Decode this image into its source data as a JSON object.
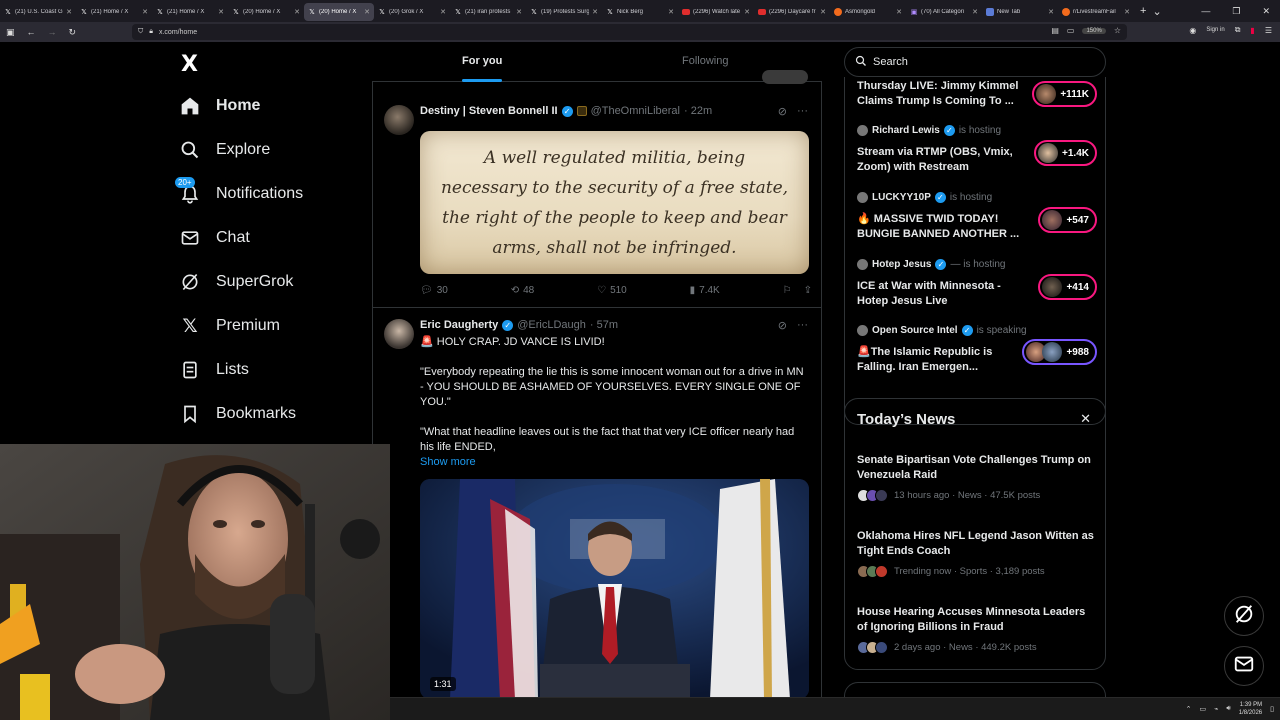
{
  "browser": {
    "tabs": [
      {
        "label": "(21) U.S. Coast G",
        "favicon": "x-icon",
        "active": false
      },
      {
        "label": "(21) Home / X",
        "favicon": "x-icon",
        "active": false
      },
      {
        "label": "(21) Home / X",
        "favicon": "x-icon",
        "active": false
      },
      {
        "label": "(20) Home / X",
        "favicon": "x-icon",
        "active": false
      },
      {
        "label": "(20) Home / X",
        "favicon": "x-icon",
        "active": true
      },
      {
        "label": "(20) Grok / X",
        "favicon": "x-icon",
        "active": false
      },
      {
        "label": "(21) iran protests",
        "favicon": "x-icon",
        "active": false
      },
      {
        "label": "(19) Protests Surg",
        "favicon": "x-icon",
        "active": false
      },
      {
        "label": "Nick Berg",
        "favicon": "x-icon",
        "active": false
      },
      {
        "label": "(2296) Watch late",
        "favicon": "youtube-icon",
        "active": false
      },
      {
        "label": "(2296) Daycare fr",
        "favicon": "youtube-icon",
        "active": false
      },
      {
        "label": "Asmongold",
        "favicon": "reddit-icon",
        "active": false
      },
      {
        "label": "(70) All Categori",
        "favicon": "twitch-icon",
        "active": false
      },
      {
        "label": "New Tab",
        "favicon": "firefox-icon",
        "active": false
      },
      {
        "label": "r/LivestreamFail",
        "favicon": "reddit-icon",
        "active": false
      }
    ],
    "url": "x.com/home",
    "zoom": "150%",
    "signin_label": "Sign in"
  },
  "nav": {
    "logo": "X",
    "items": [
      {
        "label": "Home",
        "icon": "home-icon"
      },
      {
        "label": "Explore",
        "icon": "search-icon"
      },
      {
        "label": "Notifications",
        "icon": "bell-icon",
        "badge": "20+"
      },
      {
        "label": "Chat",
        "icon": "mail-icon"
      },
      {
        "label": "SuperGrok",
        "icon": "grok-icon"
      },
      {
        "label": "Premium",
        "icon": "x-icon"
      },
      {
        "label": "Lists",
        "icon": "list-icon"
      },
      {
        "label": "Bookmarks",
        "icon": "bookmark-icon"
      }
    ]
  },
  "feed": {
    "tabs": [
      {
        "label": "For you"
      },
      {
        "label": "Following"
      }
    ],
    "tweets": [
      {
        "name": "Destiny | Steven Bonnell II",
        "handle": "@TheOmniLiberal",
        "time": "· 22m",
        "image_text": "A well regulated militia, being necessary to the security of a free state, the right of the people to keep and bear arms, shall not be infringed.",
        "replies": "30",
        "reposts": "48",
        "likes": "510",
        "views": "7.4K"
      },
      {
        "name": "Eric Daugherty",
        "handle": "@EricLDaugh",
        "time": "· 57m",
        "line1": "🚨 HOLY CRAP. JD VANCE IS LIVID!",
        "para1": "\"Everybody repeating the lie this is some innocent woman out for a drive in MN - YOU SHOULD BE ASHAMED OF YOURSELVES. EVERY SINGLE ONE OF YOU.\"",
        "para2": "\"What that headline leaves out is the fact that that very ICE officer nearly had his life ENDED,",
        "show_more": "Show more",
        "video_duration": "1:31"
      }
    ]
  },
  "right": {
    "search_placeholder": "Search",
    "live": [
      {
        "title": "Thursday LIVE: Jimmy Kimmel Claims Trump Is Coming To ...",
        "count": "+111K"
      },
      {
        "host": "Richard Lewis",
        "status": "is hosting",
        "title": "Stream via RTMP (OBS, Vmix, Zoom) with Restream",
        "count": "+1.4K"
      },
      {
        "host": "LUCKYY10P",
        "status": "is hosting",
        "title": "🔥 MASSIVE TWID TODAY! BUNGIE BANNED ANOTHER ...",
        "count": "+547"
      },
      {
        "host": "Hotep Jesus",
        "status": "— is hosting",
        "title": "ICE at War with Minnesota - Hotep Jesus Live",
        "count": "+414"
      },
      {
        "host": "Open Source Intel",
        "status": "is speaking",
        "title": "🚨The Islamic Republic is Falling. Iran Emergen...",
        "count": "+988"
      }
    ],
    "news_heading": "Today’s News",
    "news": [
      {
        "title": "Senate Bipartisan Vote Challenges Trump on Venezuela Raid",
        "meta": "13 hours ago · News · 47.5K posts"
      },
      {
        "title": "Oklahoma Hires NFL Legend Jason Witten as Tight Ends Coach",
        "meta": "Trending now · Sports · 3,189 posts"
      },
      {
        "title": "House Hearing Accuses Minnesota Leaders of Ignoring Billions in Fraud",
        "meta": "2 days ago · News · 449.2K posts"
      }
    ]
  },
  "taskbar": {
    "time": "1:39 PM",
    "date": "1/8/2026"
  },
  "colors": {
    "accent": "#1d9bf0",
    "live_pink": "#f91880",
    "live_purple": "#7856ff",
    "border": "#2f3336",
    "muted": "#71767b"
  }
}
